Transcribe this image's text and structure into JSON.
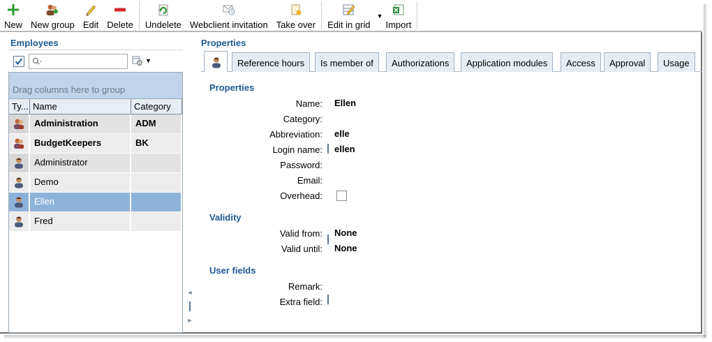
{
  "toolbar": {
    "new": "New",
    "new_group": "New group",
    "edit": "Edit",
    "delete": "Delete",
    "undelete": "Undelete",
    "webclient_invitation": "Webclient invitation",
    "take_over": "Take over",
    "edit_in_grid": "Edit in grid",
    "import": "Import"
  },
  "employees": {
    "title": "Employees",
    "group_hint": "Drag columns here to group",
    "columns": [
      "Ty...",
      "Name",
      "Category"
    ],
    "rows": [
      {
        "name": "Administration",
        "category": "ADM"
      },
      {
        "name": "BudgetKeepers",
        "category": "BK"
      },
      {
        "name": "Administrator",
        "category": ""
      },
      {
        "name": "Demo",
        "category": ""
      },
      {
        "name": "Ellen",
        "category": ""
      },
      {
        "name": "Fred",
        "category": ""
      }
    ]
  },
  "properties": {
    "title": "Properties",
    "tabs": [
      "Reference hours",
      "Is member of",
      "Authorizations",
      "Application modules",
      "Access",
      "Approval",
      "Usage"
    ],
    "section_properties": "Properties",
    "labels": {
      "name": "Name:",
      "category": "Category:",
      "abbreviation": "Abbreviation:",
      "login_name": "Login name:",
      "password": "Password:",
      "email": "Email:",
      "overhead": "Overhead:"
    },
    "values": {
      "name": "Ellen",
      "abbreviation": "elle",
      "login_name": "ellen"
    },
    "section_validity": "Validity",
    "validity": {
      "valid_from_label": "Valid from:",
      "valid_from": "None",
      "valid_until_label": "Valid until:",
      "valid_until": "None"
    },
    "section_user_fields": "User fields",
    "user_fields": {
      "remark_label": "Remark:",
      "extra_field_label": "Extra field:"
    }
  },
  "colors": {
    "accent": "#1c5a96",
    "selection": "#8eb3db",
    "group_area": "#bfd4ea"
  }
}
